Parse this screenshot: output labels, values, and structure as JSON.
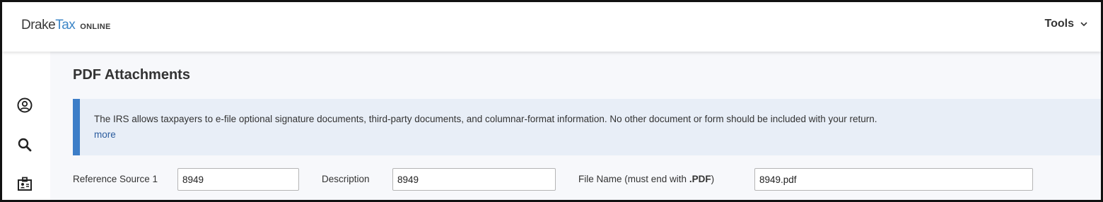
{
  "header": {
    "logo": {
      "drake": "Drake",
      "tax": "Tax",
      "online": "ONLINE"
    },
    "tools_label": "Tools"
  },
  "sidebar": {
    "icons": [
      "user-circle-icon",
      "search-icon",
      "id-badge-icon"
    ]
  },
  "main": {
    "title": "PDF Attachments",
    "info": {
      "text": "The IRS allows taxpayers to e-file optional signature documents, third-party documents, and columnar-format information. No other document or form should be included with your return.",
      "more_label": "more"
    },
    "fields": {
      "reference_source_label": "Reference Source 1",
      "reference_source_value": "8949",
      "description_label": "Description",
      "description_value": "8949",
      "file_name_label_prefix": "File Name (must end with ",
      "file_name_label_ext": ".PDF",
      "file_name_label_suffix": ")",
      "file_name_value": "8949.pdf"
    }
  },
  "colors": {
    "accent": "#3d7ec8",
    "info_bg": "#e8eef7",
    "link": "#2b5c9e",
    "logo_tax": "#3c86c7"
  }
}
